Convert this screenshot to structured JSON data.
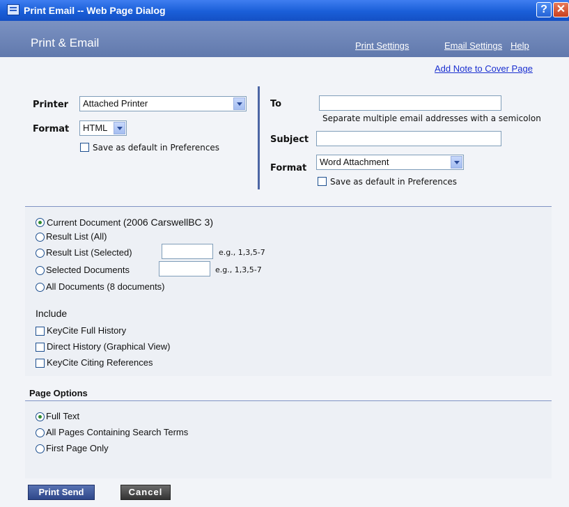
{
  "window": {
    "title": "Print Email -- Web Page Dialog",
    "help_glyph": "?",
    "close_glyph": "✕"
  },
  "header": {
    "brand": "Print & Email",
    "nav": {
      "print_settings": "Print Settings",
      "email_settings": "Email Settings",
      "help": "Help"
    }
  },
  "cover_link": "Add Note to Cover Page",
  "print": {
    "printer_label": "Printer",
    "printer_value": "Attached Printer",
    "format_label": "Format",
    "format_value": "HTML",
    "save_default": "Save as default in Preferences"
  },
  "email": {
    "to_label": "To",
    "to_value": "",
    "hint": "Separate multiple email addresses with a semicolon",
    "subject_label": "Subject",
    "subject_value": "",
    "format_label": "Format",
    "format_value": "Word Attachment",
    "save_default": "Save as default in Preferences"
  },
  "scope": {
    "current": "Current Document",
    "current_detail": "(2006 CarswellBC 3)",
    "result_all": "Result List (All)",
    "result_selected": "Result List (Selected)",
    "selected_docs": "Selected Documents",
    "example": "e.g., 1,3,5-7",
    "all_docs": "All Documents (8 documents)",
    "selected_option": "current"
  },
  "include": {
    "label": "Include",
    "items": [
      "KeyCite Full History",
      "Direct History (Graphical View)",
      "KeyCite Citing References"
    ]
  },
  "page_options": {
    "title": "Page Options",
    "items": [
      "Full Text",
      "All Pages Containing Search Terms",
      "First Page Only"
    ],
    "selected_option": "Full Text"
  },
  "buttons": {
    "send": "Print Send",
    "cancel": "Cancel"
  }
}
